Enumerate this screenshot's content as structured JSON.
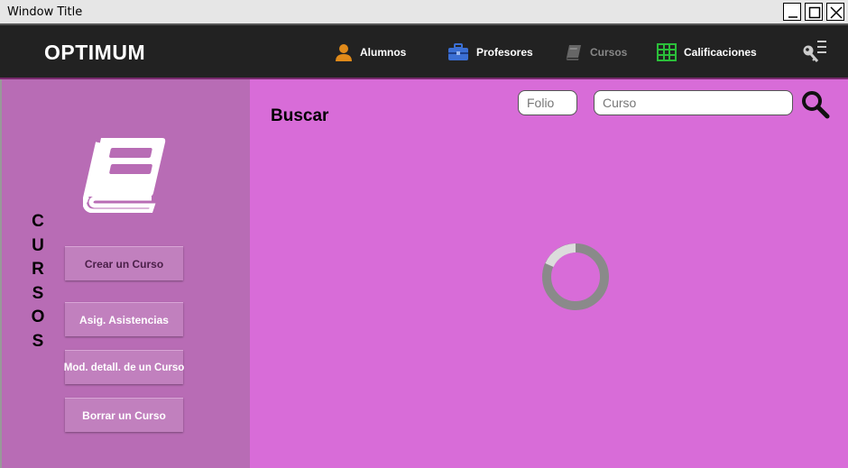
{
  "window": {
    "title": "Window Title"
  },
  "navbar": {
    "brand": "OPTIMUM",
    "items": [
      {
        "label": "Alumnos",
        "icon": "user-icon"
      },
      {
        "label": "Profesores",
        "icon": "briefcase-icon"
      },
      {
        "label": "Cursos",
        "icon": "book-icon",
        "state": "current-disabled"
      },
      {
        "label": "Calificaciones",
        "icon": "grid-icon"
      }
    ],
    "settings_icon": "key-menu-icon"
  },
  "sidebar": {
    "title": "CURSOS",
    "icon": "book-icon",
    "buttons": [
      {
        "label": "Crear un Curso"
      },
      {
        "label": "Asig. Asistencias"
      },
      {
        "label": "Mod. detall. de un Curso"
      },
      {
        "label": "Borrar un Curso"
      }
    ]
  },
  "main": {
    "heading": "Buscar",
    "folio_placeholder": "Folio",
    "curso_placeholder": "Curso",
    "search_icon": "magnifier-icon",
    "loading_icon": "spinner-icon"
  },
  "colors": {
    "navbar_bg": "#222222",
    "sidebar_bg": "#b86cb5",
    "main_bg": "#d86cd8",
    "sidebar_button_bg": "#c180be",
    "alumnos_icon": "#e08a1a",
    "profesores_icon": "#3b6fd4",
    "calificaciones_icon": "#2bbf3a"
  }
}
